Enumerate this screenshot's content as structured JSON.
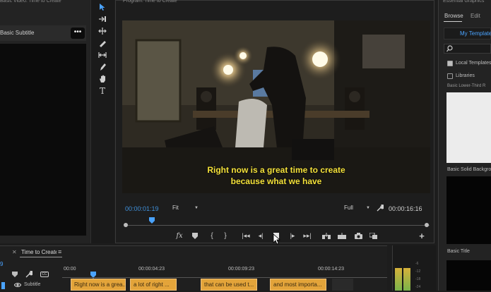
{
  "source_panel": {
    "tab_title": "Basic Video: Time to Create",
    "clip_label": "Basic Subtitle",
    "menu_icon": "more-dots-icon"
  },
  "tools": [
    "selection-icon",
    "track-select-icon",
    "ripple-edit-icon",
    "razor-icon",
    "slip-icon",
    "pen-icon",
    "hand-icon",
    "type-icon"
  ],
  "program": {
    "title": "Program: Time to Create",
    "caption_line1": "Right now is a great time to create",
    "caption_line2": "because what we have",
    "timecode_current": "00:00:01:19",
    "zoom": "Fit",
    "resolution": "Full",
    "timecode_duration": "00:00:16:16",
    "playhead_fraction": 0.08
  },
  "essential_graphics": {
    "title": "Essential Graphics",
    "tab_browse": "Browse",
    "tab_edit": "Edit",
    "dropdown": "My Templates",
    "checkbox_local": "Local Templates",
    "checkbox_libraries": "Libraries",
    "item1": "Basic Lower-Third R",
    "item2": "Basic Solid Backgrou",
    "item3": "Basic Title"
  },
  "timeline": {
    "tab": "Time to Create",
    "timecode": "9",
    "ruler": [
      "00:00",
      "00:00:04:23",
      "00:00:09:23",
      "00:00:14:23"
    ],
    "track_label": "Subtitle",
    "clips": [
      "Right now is a grea...",
      "a lot of right ...",
      "that can be used t...",
      "and most importa..."
    ]
  },
  "colors": {
    "accent": "#4aa3ff",
    "timecode_blue": "#3f8fd8",
    "clip": "#e3a43a",
    "caption": "#f4e13a",
    "background": "#1d1d1d"
  }
}
